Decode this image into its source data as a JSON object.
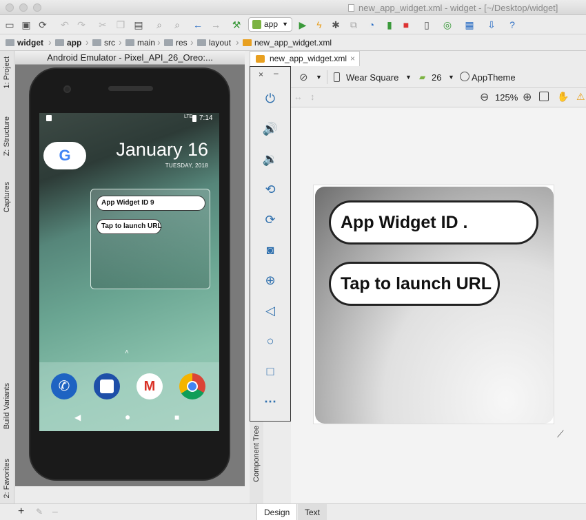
{
  "window": {
    "title": "new_app_widget.xml - widget - [~/Desktop/widget]"
  },
  "toolbar": {
    "run_config": "app",
    "icons": [
      "open-folder-icon",
      "save-icon",
      "sync-icon",
      "undo-icon",
      "redo-icon",
      "cut-icon",
      "copy-icon",
      "paste-icon",
      "find-icon",
      "replace-icon",
      "back-icon",
      "forward-icon",
      "build-icon",
      "run-icon",
      "apply-changes-icon",
      "debug-icon",
      "attach-icon",
      "profile-icon",
      "coverage-icon",
      "stop-icon",
      "avd-manager-icon",
      "sync-gradle-icon",
      "project-structure-icon",
      "sdk-manager-icon",
      "help-icon"
    ]
  },
  "breadcrumbs": [
    "widget",
    "app",
    "src",
    "main",
    "res",
    "layout",
    "new_app_widget.xml"
  ],
  "left_tabs": [
    "1: Project",
    "Z: Structure",
    "Captures",
    "Build Variants",
    "2: Favorites"
  ],
  "emulator": {
    "title": "Android Emulator - Pixel_API_26_Oreo:...",
    "time": "7:14",
    "network": "LTE",
    "date": "January 16",
    "day": "TUESDAY, 2018",
    "widget_id_label": "App Widget ID 9",
    "launch_label": "Tap to launch URL",
    "search_letter": "G"
  },
  "emulator_controls": [
    "close",
    "minimize",
    "power",
    "volume-up",
    "volume-down",
    "rotate-left",
    "rotate-right",
    "screenshot",
    "zoom",
    "back",
    "home",
    "overview",
    "more"
  ],
  "editor": {
    "tab": "new_app_widget.xml",
    "device": "Wear Square",
    "api": "26",
    "theme": "AppTheme",
    "zoom": "125%",
    "preview_id": "App Widget ID .",
    "preview_launch": "Tap to launch URL",
    "component_tree": "Component Tree"
  },
  "bottom": {
    "design_tab": "Design",
    "text_tab": "Text"
  },
  "colors": {
    "accent": "#2e6fad",
    "run_green": "#3b9a3b",
    "stop_red": "#dd3333"
  }
}
